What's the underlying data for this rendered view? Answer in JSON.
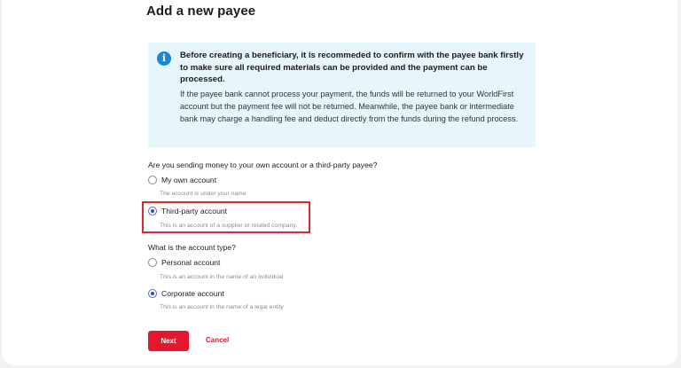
{
  "page": {
    "title": "Add a new payee"
  },
  "notice": {
    "icon": "info-icon",
    "icon_glyph": "i",
    "bold_text": "Before creating a beneficiary, it is recommeded to confirm with the payee bank firstly to make sure all required materials can be provided and the payment can be processed.",
    "body_text": "If the payee bank cannot process your payment, the funds will be returned to your WorldFirst account but the payment fee will not be returned. Meanwhile, the payee bank or intermediate bank may charge a handling fee and deduct directly from the funds during the refund process."
  },
  "recipient_question": {
    "label": "Are you sending money to your own account or a third-party payee?",
    "options": [
      {
        "label": "My own account",
        "description": "The account is under your name",
        "selected": false
      },
      {
        "label": "Third-party account",
        "description": "This is an account of a supplier or related company.",
        "selected": true
      }
    ]
  },
  "account_type_question": {
    "label": "What is the account type?",
    "options": [
      {
        "label": "Personal account",
        "description": "This is an account in the name of an individual",
        "selected": false
      },
      {
        "label": "Corporate account",
        "description": "This is an account in the name of a legal entity",
        "selected": true
      }
    ]
  },
  "actions": {
    "next_label": "Next",
    "cancel_label": "Cancel"
  },
  "colors": {
    "primary": "#e5172d",
    "info_background": "#e7f5fd",
    "info_icon": "#1a86d9",
    "radio_selected": "#3646c9",
    "highlight_box": "#e0262f"
  }
}
